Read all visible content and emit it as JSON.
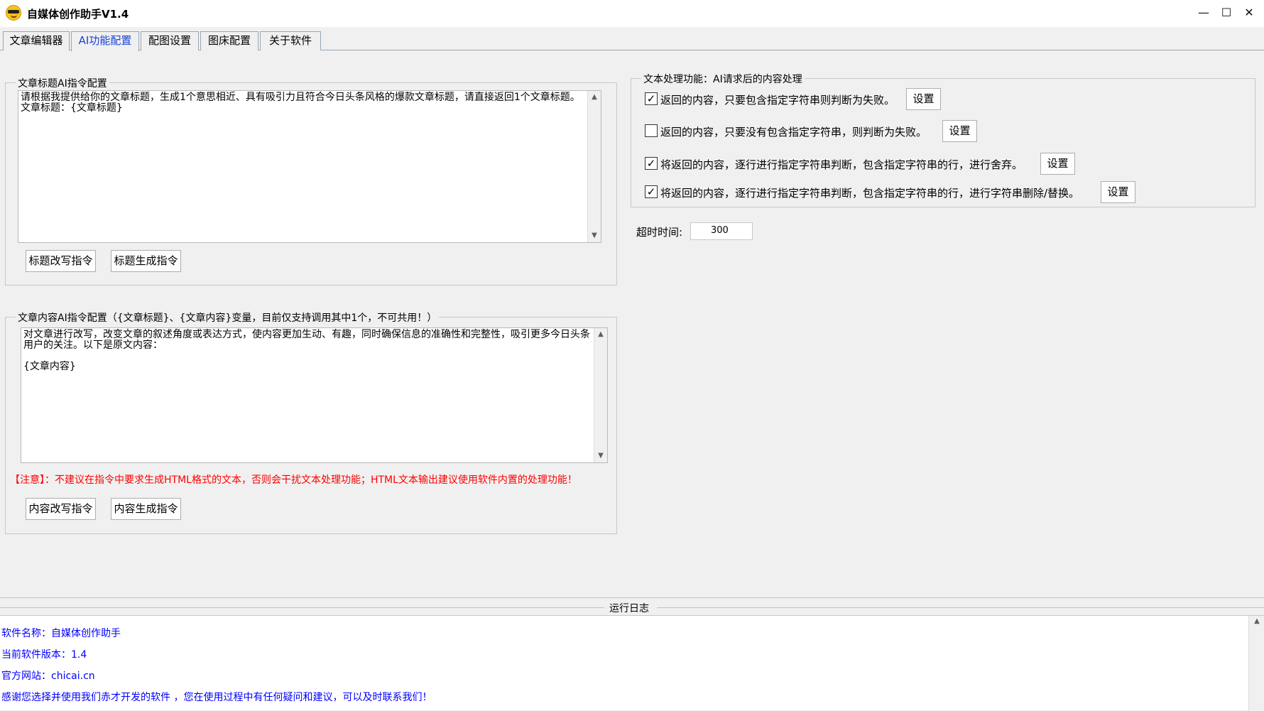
{
  "window": {
    "title": "自媒体创作助手V1.4",
    "minimize": "—",
    "maximize": "☐",
    "close": "✕"
  },
  "tabs": [
    {
      "label": "文章编辑器"
    },
    {
      "label": "AI功能配置",
      "active": true
    },
    {
      "label": "配图设置"
    },
    {
      "label": "图床配置"
    },
    {
      "label": "关于软件"
    }
  ],
  "title_group": {
    "title": "文章标题AI指令配置",
    "prompt": "请根据我提供给你的文章标题，生成1个意思相近、具有吸引力且符合今日头条风格的爆款文章标题，请直接返回1个文章标题。文章标题：{文章标题}",
    "btn_rewrite": "标题改写指令",
    "btn_generate": "标题生成指令"
  },
  "content_group": {
    "title": "文章内容AI指令配置（{文章标题}、{文章内容}变量，目前仅支持调用其中1个，不可共用！）",
    "prompt": "对文章进行改写，改变文章的叙述角度或表达方式，使内容更加生动、有趣，同时确保信息的准确性和完整性，吸引更多今日头条用户的关注。以下是原文内容：\n\n{文章内容}",
    "warning": "【注意】：不建议在指令中要求生成HTML格式的文本，否则会干扰文本处理功能；HTML文本输出建议使用软件内置的处理功能！",
    "btn_rewrite": "内容改写指令",
    "btn_generate": "内容生成指令"
  },
  "text_processing": {
    "title": "文本处理功能：AI请求后的内容处理",
    "options": [
      {
        "label": "返回的内容，只要包含指定字符串则判断为失败。",
        "checked": true,
        "checkmark": "✓",
        "button": "设置"
      },
      {
        "label": "返回的内容，只要没有包含指定字符串，则判断为失败。",
        "checked": false,
        "checkmark": "",
        "button": "设置"
      },
      {
        "label": "将返回的内容，逐行进行指定字符串判断，包含指定字符串的行，进行舍弃。",
        "checked": true,
        "checkmark": "✓",
        "button": "设置"
      },
      {
        "label": "将返回的内容，逐行进行指定字符串判断，包含指定字符串的行，进行字符串删除/替换。",
        "checked": true,
        "checkmark": "✓",
        "button": "设置"
      }
    ]
  },
  "timeout": {
    "label": "超时时间:",
    "value": "300"
  },
  "log": {
    "title": "运行日志",
    "lines": [
      "软件名称：自媒体创作助手",
      "当前软件版本：1.4",
      "官方网站：chicai.cn",
      "感谢您选择并使用我们赤才开发的软件 ，您在使用过程中有任何疑问和建议，可以及时联系我们！"
    ]
  },
  "scroll_icons": {
    "up": "▲",
    "down": "▼"
  }
}
